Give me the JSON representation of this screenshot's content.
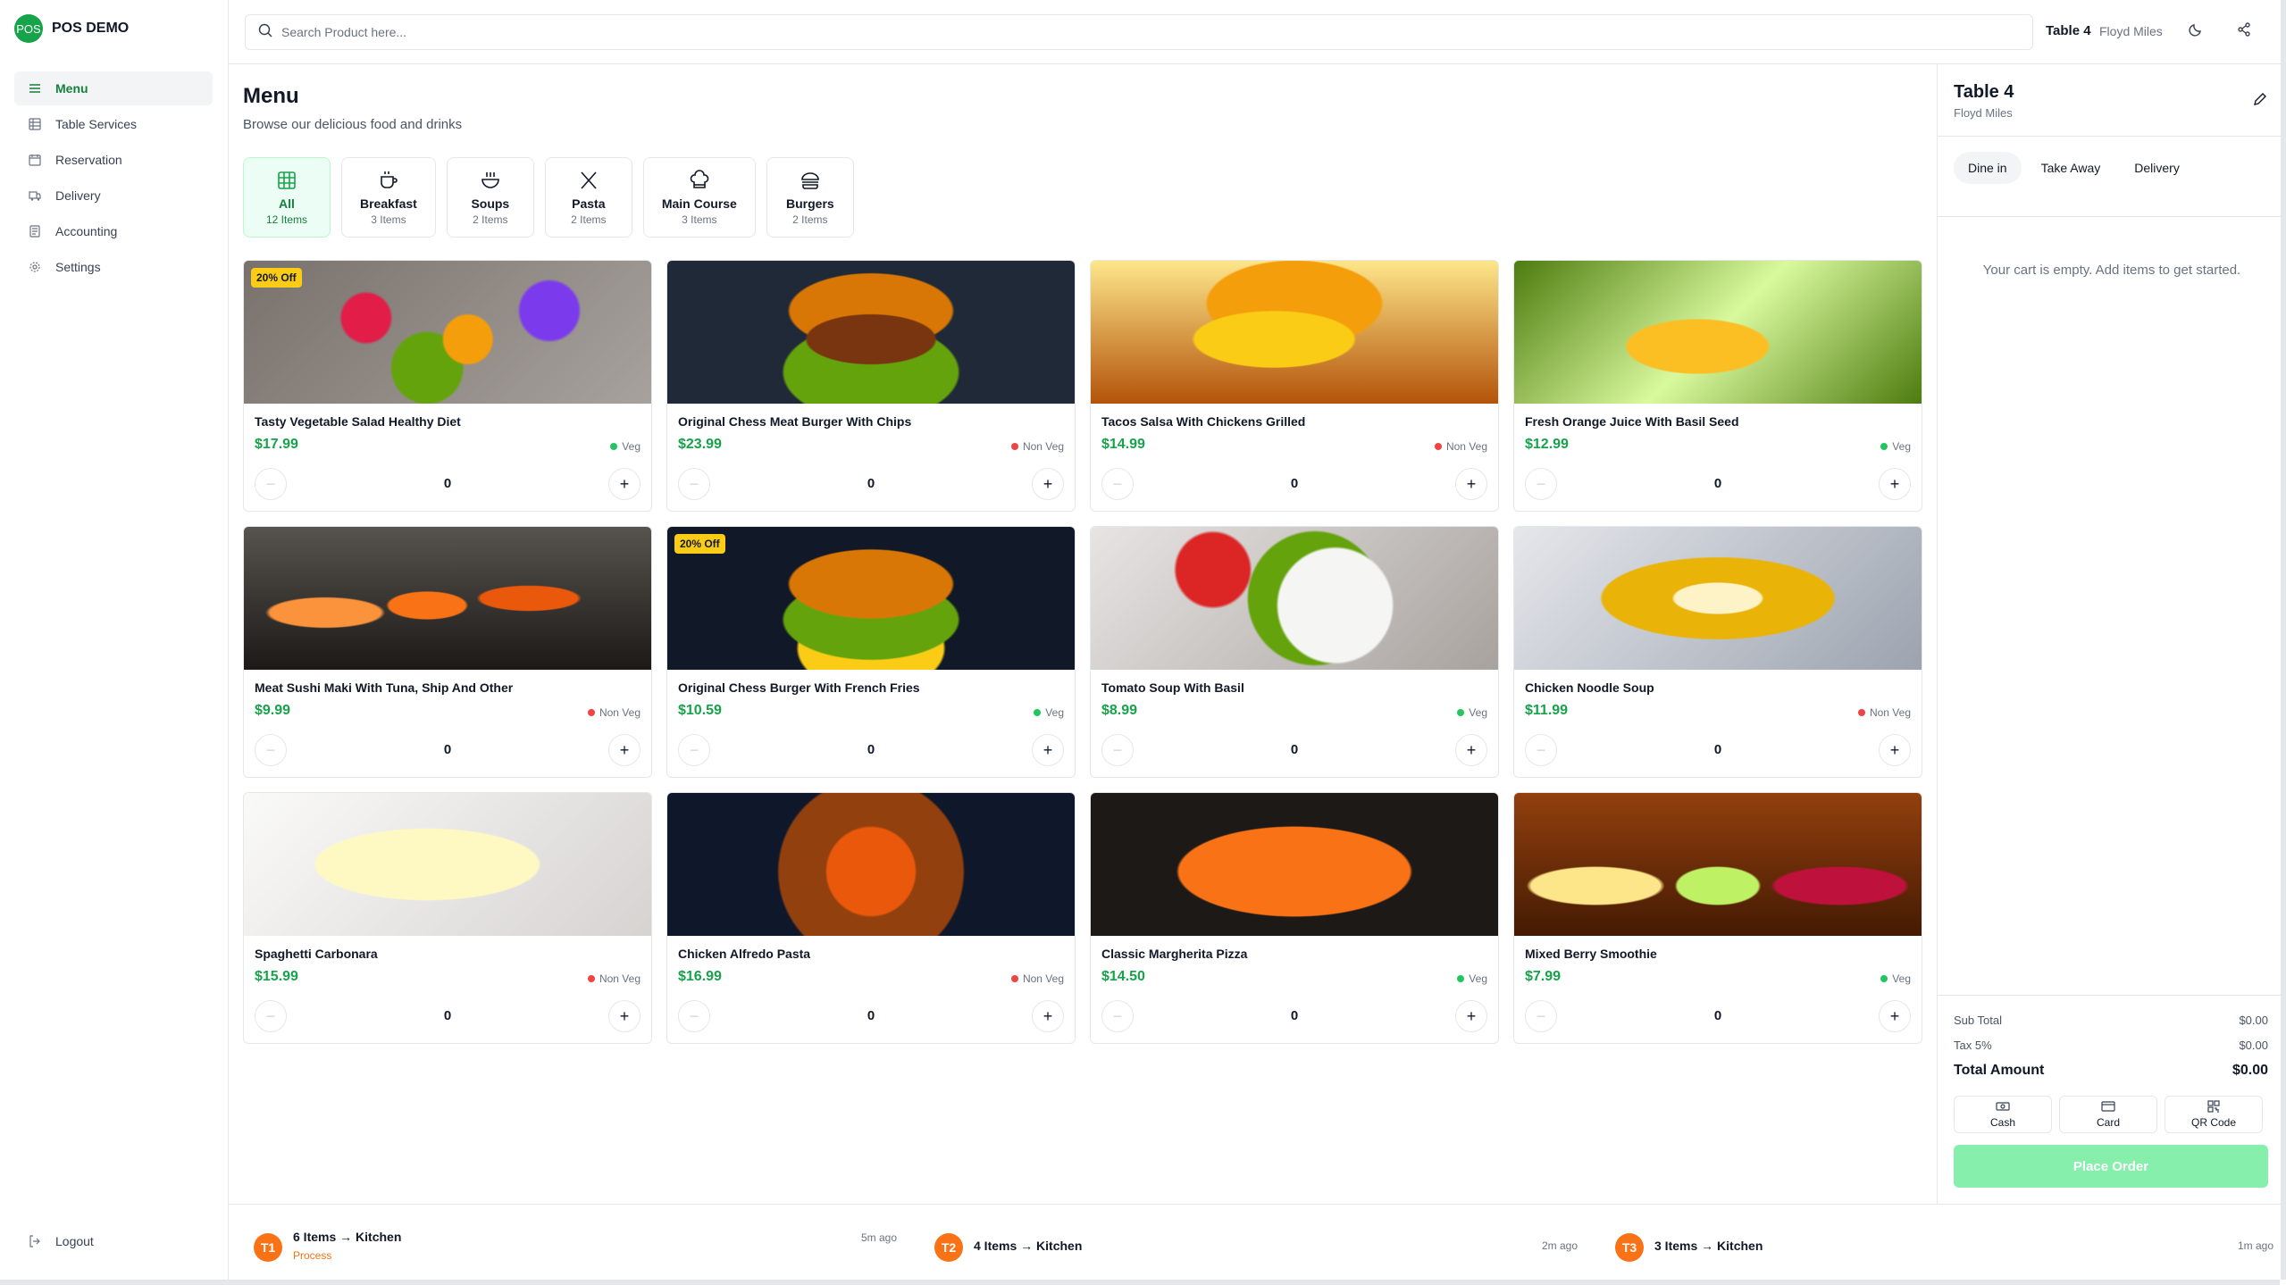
{
  "brand": {
    "logo": "POS",
    "name": "POS DEMO"
  },
  "sidebar": {
    "items": [
      {
        "label": "Menu",
        "icon": "menu-icon"
      },
      {
        "label": "Table Services",
        "icon": "table-icon"
      },
      {
        "label": "Reservation",
        "icon": "calendar-icon"
      },
      {
        "label": "Delivery",
        "icon": "truck-icon"
      },
      {
        "label": "Accounting",
        "icon": "document-icon"
      },
      {
        "label": "Settings",
        "icon": "gear-icon"
      }
    ],
    "logout": "Logout"
  },
  "topbar": {
    "search_placeholder": "Search Product here...",
    "table": "Table 4",
    "customer": "Floyd Miles"
  },
  "main": {
    "title": "Menu",
    "subtitle": "Browse our delicious food and drinks",
    "categories": [
      {
        "name": "All",
        "count": "12 Items"
      },
      {
        "name": "Breakfast",
        "count": "3 Items"
      },
      {
        "name": "Soups",
        "count": "2 Items"
      },
      {
        "name": "Pasta",
        "count": "2 Items"
      },
      {
        "name": "Main Course",
        "count": "3 Items"
      },
      {
        "name": "Burgers",
        "count": "2 Items"
      }
    ],
    "products": [
      {
        "name": "Tasty Vegetable Salad Healthy Diet",
        "price": "$17.99",
        "type": "Veg",
        "qty": "0",
        "badge": "20% Off"
      },
      {
        "name": "Original Chess Meat Burger With Chips",
        "price": "$23.99",
        "type": "Non Veg",
        "qty": "0",
        "badge": ""
      },
      {
        "name": "Tacos Salsa With Chickens Grilled",
        "price": "$14.99",
        "type": "Non Veg",
        "qty": "0",
        "badge": ""
      },
      {
        "name": "Fresh Orange Juice With Basil Seed",
        "price": "$12.99",
        "type": "Veg",
        "qty": "0",
        "badge": ""
      },
      {
        "name": "Meat Sushi Maki With Tuna, Ship And Other",
        "price": "$9.99",
        "type": "Non Veg",
        "qty": "0",
        "badge": ""
      },
      {
        "name": "Original Chess Burger With French Fries",
        "price": "$10.59",
        "type": "Veg",
        "qty": "0",
        "badge": "20% Off"
      },
      {
        "name": "Tomato Soup With Basil",
        "price": "$8.99",
        "type": "Veg",
        "qty": "0",
        "badge": ""
      },
      {
        "name": "Chicken Noodle Soup",
        "price": "$11.99",
        "type": "Non Veg",
        "qty": "0",
        "badge": ""
      },
      {
        "name": "Spaghetti Carbonara",
        "price": "$15.99",
        "type": "Non Veg",
        "qty": "0",
        "badge": ""
      },
      {
        "name": "Chicken Alfredo Pasta",
        "price": "$16.99",
        "type": "Non Veg",
        "qty": "0",
        "badge": ""
      },
      {
        "name": "Classic Margherita Pizza",
        "price": "$14.50",
        "type": "Veg",
        "qty": "0",
        "badge": ""
      },
      {
        "name": "Mixed Berry Smoothie",
        "price": "$7.99",
        "type": "Veg",
        "qty": "0",
        "badge": ""
      }
    ]
  },
  "order_panel": {
    "title": "Table 4",
    "customer": "Floyd Miles",
    "tabs": [
      "Dine in",
      "Take Away",
      "Delivery"
    ],
    "empty_message": "Your cart is empty. Add items to get started.",
    "sub_total_label": "Sub Total",
    "sub_total": "$0.00",
    "tax_label": "Tax 5%",
    "tax": "$0.00",
    "total_label": "Total Amount",
    "total": "$0.00",
    "payments": [
      "Cash",
      "Card",
      "QR Code"
    ],
    "place_order": "Place Order"
  },
  "kitchen_orders": [
    {
      "badge": "T1",
      "title": "6 Items → Kitchen",
      "status": "Process",
      "time": "5m ago"
    },
    {
      "badge": "T2",
      "title": "4 Items → Kitchen",
      "status": "",
      "time": "2m ago"
    },
    {
      "badge": "T3",
      "title": "3 Items → Kitchen",
      "status": "",
      "time": "1m ago"
    }
  ],
  "colors": {
    "accent": "#16a34a",
    "veg": "#22c55e",
    "non_veg": "#ef4444",
    "badge": "#facc15",
    "kitchen_badge": "#f97316",
    "place_order_disabled": "#86efac"
  }
}
